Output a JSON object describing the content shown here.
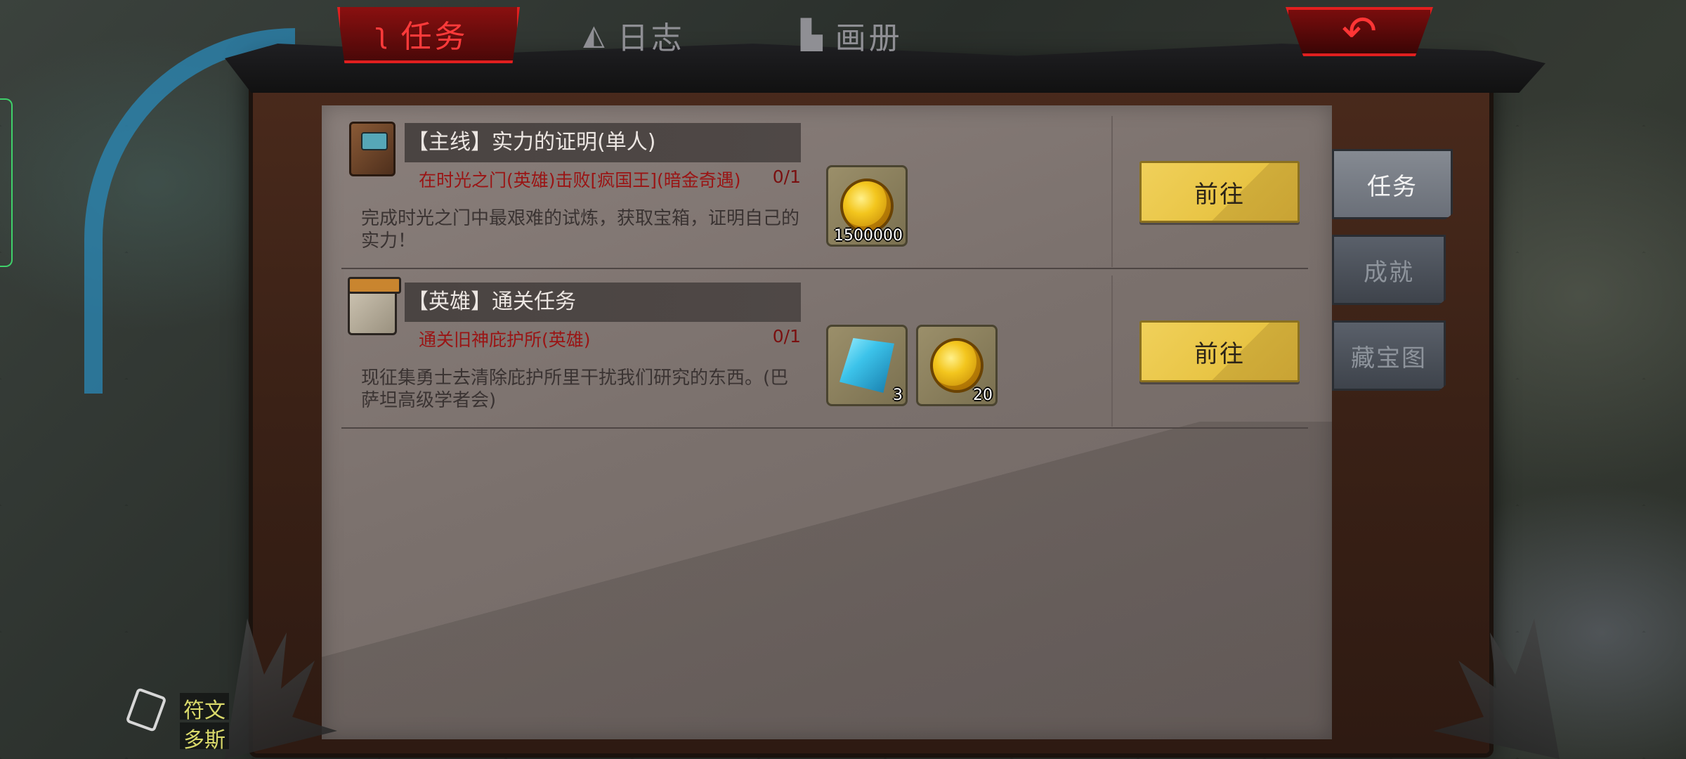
{
  "top_tabs": [
    {
      "label": "任务",
      "icon": "scroll-icon",
      "active": true
    },
    {
      "label": "日志",
      "icon": "horn-icon",
      "active": false
    },
    {
      "label": "画册",
      "icon": "album-icon",
      "active": false
    }
  ],
  "back_button": {
    "icon": "back-arrow-icon",
    "glyph": "↶"
  },
  "quests": [
    {
      "title": "【主线】实力的证明(单人)",
      "icon": "book-icon",
      "goal": "在时光之门(英雄)击败[疯国王](暗金奇遇)",
      "progress": "0/1",
      "description": "完成时光之门中最艰难的试炼，获取宝箱，证明自己的实力！",
      "rewards": [
        {
          "type": "gold-coin",
          "count": "1500000"
        }
      ],
      "action_label": "前往"
    },
    {
      "title": "【英雄】通关任务",
      "icon": "calendar-icon",
      "goal": "通关旧神庇护所(英雄)",
      "progress": "0/1",
      "description": "现征集勇士去清除庇护所里干扰我们研究的东西。(巴萨坦高级学者会)",
      "rewards": [
        {
          "type": "blue-gem",
          "count": "3"
        },
        {
          "type": "gold-coin",
          "count": "20"
        }
      ],
      "action_label": "前往"
    }
  ],
  "side_tabs": [
    {
      "label": "任务",
      "active": true
    },
    {
      "label": "成就",
      "active": false
    },
    {
      "label": "藏宝图",
      "active": false
    }
  ],
  "rune_widget": {
    "label_1": "符文",
    "label_2": "多斯"
  },
  "colors": {
    "accent_red": "#e11f1f",
    "button_gold": "#e8c444",
    "goal_text": "#9a1414"
  }
}
